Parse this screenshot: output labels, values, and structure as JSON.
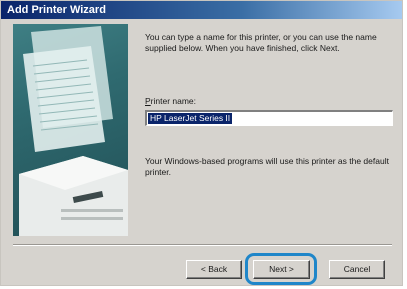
{
  "window": {
    "title": "Add Printer Wizard"
  },
  "content": {
    "description": "You can type a name for this printer, or you can use the name supplied below. When you have finished, click Next.",
    "printer_name_label": "Printer name:",
    "printer_name_value": "HP LaserJet Series II",
    "note": "Your Windows-based programs will use this printer as the default printer."
  },
  "buttons": {
    "back": "< Back",
    "next": "Next >",
    "cancel": "Cancel"
  },
  "colors": {
    "title_bar": "#0a246a",
    "selection": "#0a246a",
    "highlight_ring": "#1f86c9"
  },
  "icons": {
    "wizard_art": "printer-illustration"
  }
}
